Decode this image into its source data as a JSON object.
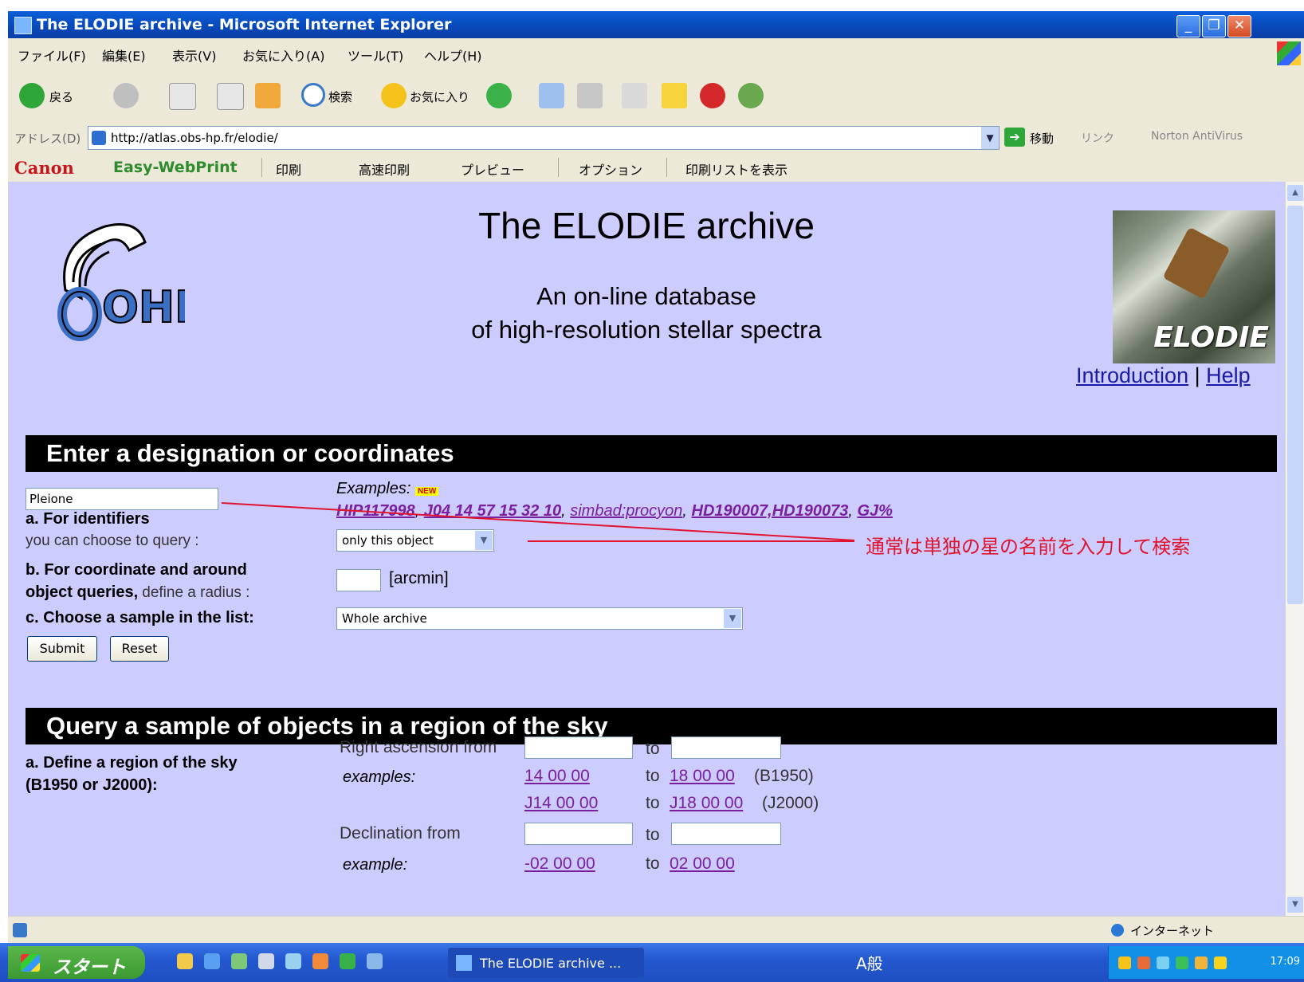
{
  "window": {
    "title": "The ELODIE archive - Microsoft Internet Explorer"
  },
  "menu": [
    "ファイル(F)",
    "編集(E)",
    "表示(V)",
    "お気に入り(A)",
    "ツール(T)",
    "ヘルプ(H)"
  ],
  "toolbar": {
    "back": "戻る",
    "search": "検索",
    "favorites": "お気に入り"
  },
  "address": {
    "label": "アドレス(D)",
    "url": "http://atlas.obs-hp.fr/elodie/",
    "go": "移動",
    "links": "リンク",
    "norton": "Norton AntiVirus"
  },
  "canonbar": {
    "brand": "Canon",
    "product": "Easy-WebPrint",
    "print": "印刷",
    "fast_print": "高速印刷",
    "preview": "プレビュー",
    "options": "オプション",
    "print_list": "印刷リストを表示"
  },
  "header": {
    "title": "The ELODIE archive",
    "subtitle1": "An on-line database",
    "subtitle2": "of high-resolution stellar spectra",
    "logo_text": "OHP",
    "image_label": "ELODIE",
    "link_intro": "Introduction",
    "link_sep": "|",
    "link_help": "Help"
  },
  "section1": {
    "heading": "Enter a designation or coordinates",
    "query_value": "Pleione",
    "examples_label": "Examples:",
    "new_badge": "NEW",
    "examples": [
      "HIP117998",
      "J04 14 57 15 32 10",
      "simbad:procyon",
      "HD190007,HD190073",
      "GJ%"
    ],
    "a_bold": "a. For identifiers",
    "a_normal": "you can choose to query :",
    "a_select": "only this object",
    "b_bold1": "b. For coordinate and around",
    "b_bold2": "object queries,",
    "b_normal": "define a radius :",
    "b_unit": "[arcmin]",
    "c_bold": "c. Choose a sample in the list:",
    "c_select": "Whole archive",
    "submit": "Submit",
    "reset": "Reset",
    "annotation": "通常は単独の星の名前を入力して検索"
  },
  "section2": {
    "heading": "Query a sample of objects in a region of the sky",
    "a_label1": "a. Define a region of the sky",
    "a_label2": "(B1950 or J2000):",
    "ra_from": "Right ascension from",
    "to": "to",
    "examples_label": "examples:",
    "ra_ex1_from": "14 00 00",
    "ra_ex1_to": "18 00 00",
    "ra_ex1_tag": "(B1950)",
    "ra_ex2_from": "J14 00 00",
    "ra_ex2_to": "J18 00 00",
    "ra_ex2_tag": "(J2000)",
    "dec_from": "Declination from",
    "example_label": "example:",
    "dec_ex_from": "-02 00 00",
    "dec_ex_to": "02 00 00"
  },
  "statusbar": {
    "zone": "インターネット"
  },
  "taskbar": {
    "start": "スタート",
    "task": "The ELODIE archive ...",
    "ime": "A般",
    "clock": "17:09"
  }
}
